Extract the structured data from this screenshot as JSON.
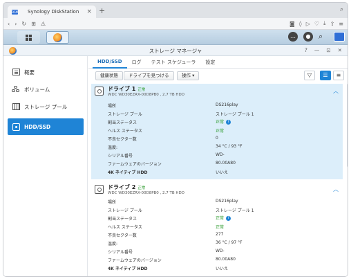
{
  "browser": {
    "tab_title": "Synology DiskStation",
    "favicon_text": "DSM"
  },
  "window": {
    "title": "ストレージ マネージャ",
    "controls": [
      "?",
      "—",
      "⊡",
      "✕"
    ]
  },
  "sidebar": {
    "items": [
      {
        "label": "概要",
        "icon": "overview-icon"
      },
      {
        "label": "ボリューム",
        "icon": "volume-icon"
      },
      {
        "label": "ストレージ プール",
        "icon": "storage-pool-icon"
      },
      {
        "label": "HDD/SSD",
        "icon": "hdd-icon",
        "active": true
      }
    ]
  },
  "tabs": [
    "HDD/SSD",
    "ログ",
    "テスト スケジューラ",
    "設定"
  ],
  "toolbar": {
    "health_label": "健康状態",
    "locate_label": "ドライブを見つける",
    "action_label": "操作 ▾"
  },
  "property_labels": {
    "location": "場所",
    "storage_pool": "ストレージ プール",
    "allocation_status": "割当ステータス",
    "health_status": "ヘルス ステータス",
    "bad_sectors": "不良セクター数",
    "temperature": "温度:",
    "serial": "シリアル番号",
    "firmware": "ファームウェアのバージョン",
    "native_4k": "4K ネイティブ HDD"
  },
  "drives": [
    {
      "name": "ドライブ 1",
      "status": "正常",
      "model": "WDC WD30EZRX-00D8PB0 , 2.7 TB HDD",
      "location": "DS216play",
      "storage_pool": "ストレージ プール 1",
      "allocation_status": "正常",
      "health_status": "正常",
      "bad_sectors": "0",
      "temperature": "34 °C / 93 °F",
      "serial": "WD-",
      "firmware": "80.00A80",
      "native_4k": "いいえ",
      "selected": true
    },
    {
      "name": "ドライブ 2",
      "status": "正常",
      "model": "WDC WD30EZRX-00D8PB0 , 2.7 TB HDD",
      "location": "DS216play",
      "storage_pool": "ストレージ プール 1",
      "allocation_status": "正常",
      "health_status": "正常",
      "bad_sectors": "277",
      "temperature": "36 °C / 97 °F",
      "serial": "WD-",
      "firmware": "80.00A80",
      "native_4k": "いいえ",
      "selected": false
    }
  ],
  "colors": {
    "accent": "#1f84d6",
    "ok_green": "#2b9a2b",
    "selected_row": "#dceefa"
  }
}
